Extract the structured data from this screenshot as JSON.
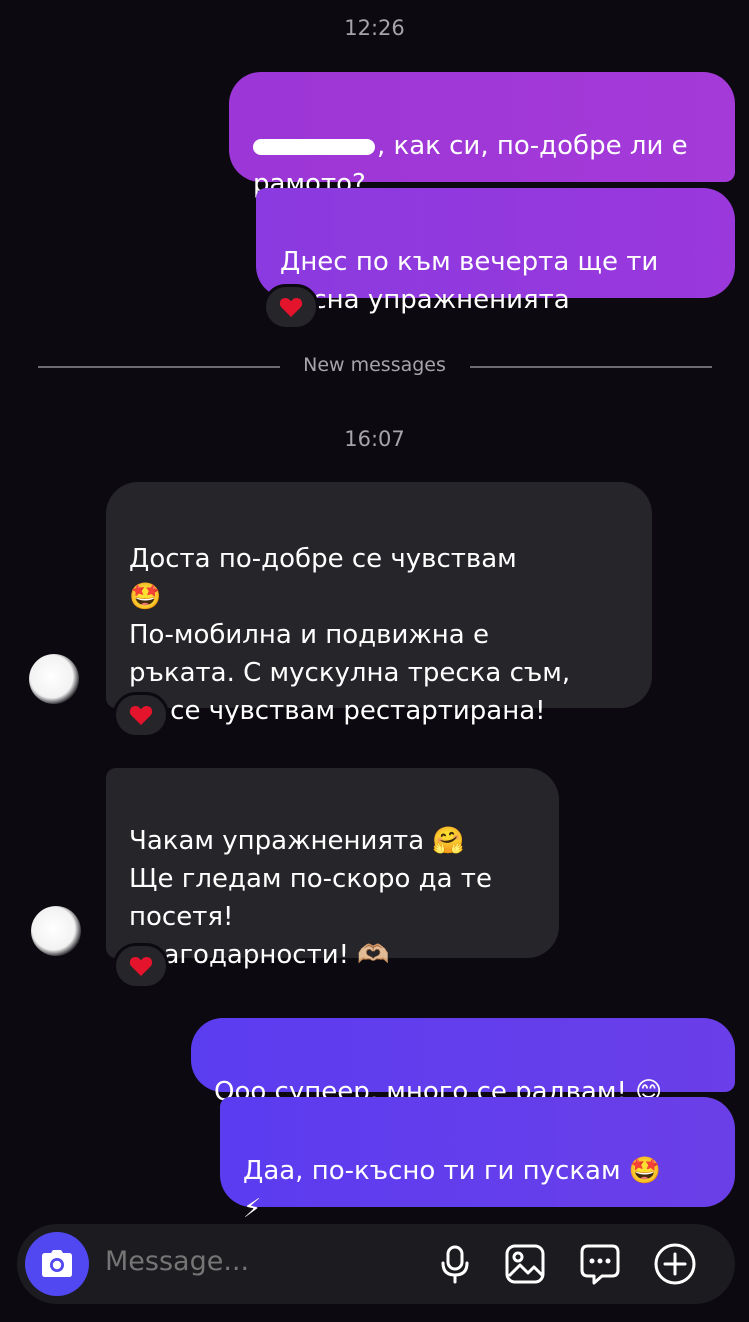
{
  "chat": {
    "time_1": "12:26",
    "msg_out_1_text": ", как си, по-добре ли е\nрамото?",
    "msg_out_2_text": "Днес по към вечерта ще ти\nпусна упражненията",
    "new_messages_label": "New messages",
    "time_2": "16:07",
    "msg_in_1_text": "Доста по-добре се чувствам\n🤩\nПо-мобилна и подвижна е\nръката. С мускулна треска съм,\nно се чувствам рестартирана!",
    "msg_in_2_text": "Чакам упражненията 🤗\nЩе гледам по-скоро да те\nпосетя!\nБлагодарности! 🫶🏼",
    "msg_out_3_text": "Ооо супеер, много се радвам! 😊",
    "msg_out_4_text": "Даа, по-късно ти ги пускам 🤩\n⚡",
    "reaction_icon": "red-heart",
    "accent_color": "#5148f2"
  },
  "composer": {
    "placeholder": "Message..."
  }
}
